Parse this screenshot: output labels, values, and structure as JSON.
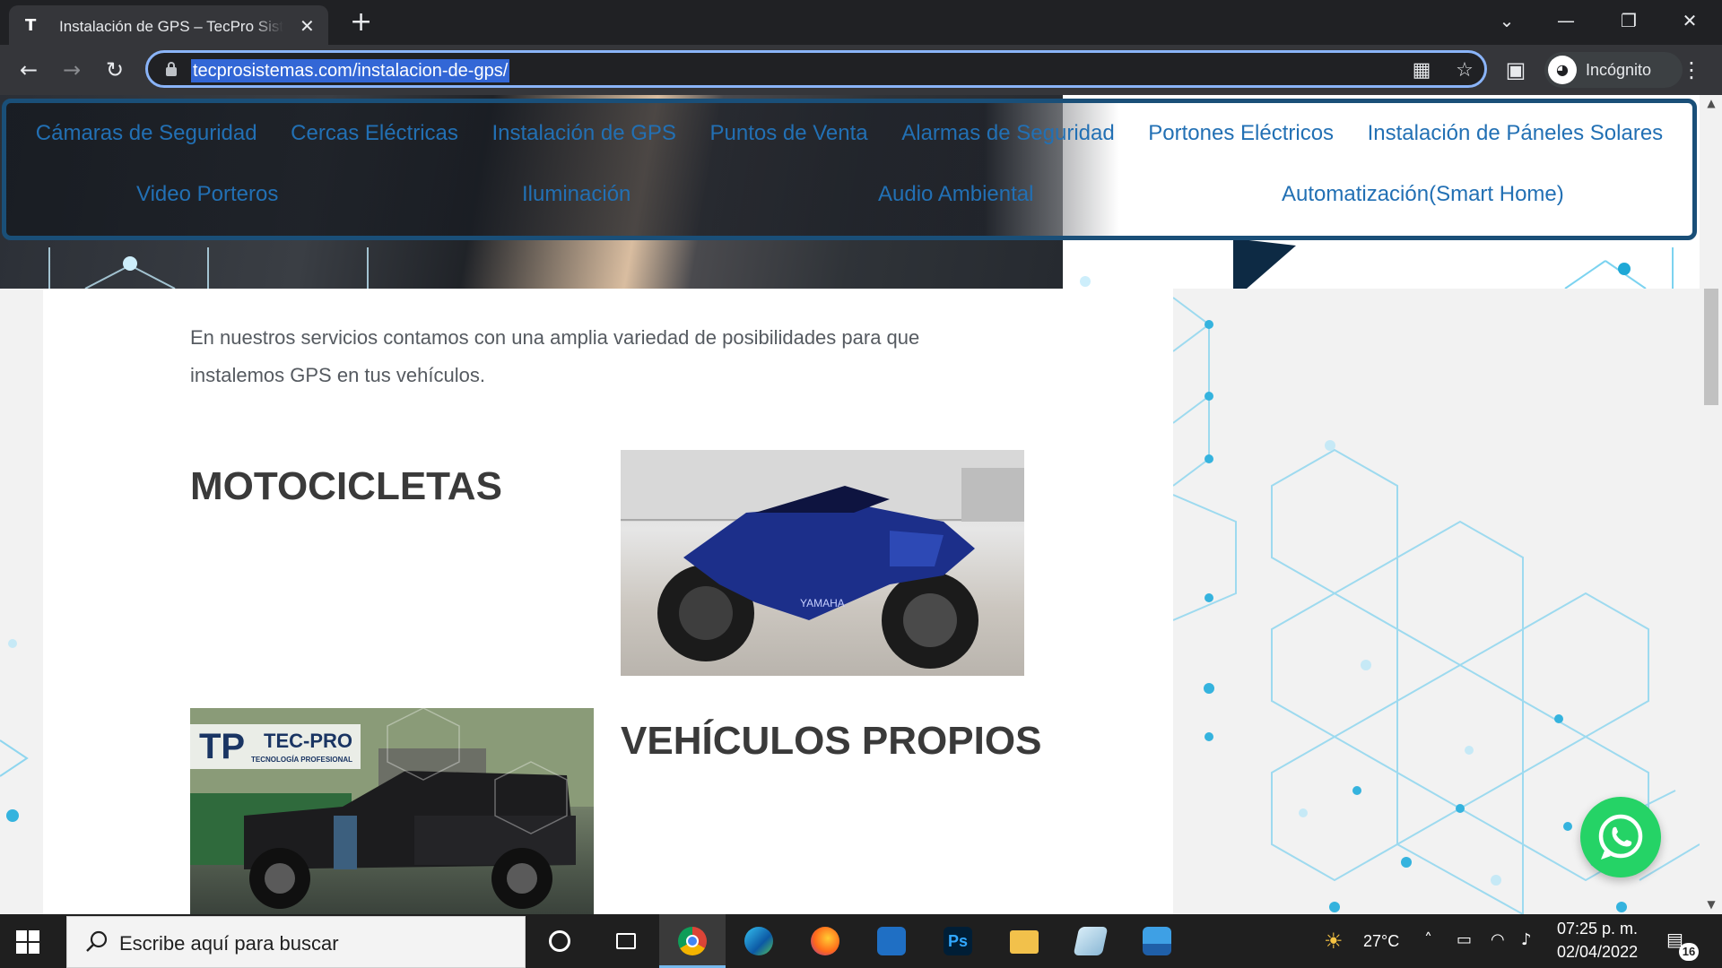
{
  "browser": {
    "tab_title": "Instalación de GPS – TecPro Sistemas",
    "tab_favicon": "T",
    "close_glyph": "✕",
    "new_tab_glyph": "+",
    "url": "tecprosistemas.com/instalacion-de-gps/",
    "incognito_label": "Incógnito",
    "icons": [
      "back-arrow-icon",
      "forward-arrow-icon",
      "reload-icon",
      "lock-icon",
      "qr-icon",
      "star-icon",
      "sidebar-icon",
      "incognito-icon",
      "menu-icon"
    ]
  },
  "nav": {
    "row1": [
      "Cámaras de Seguridad",
      "Cercas Eléctricas",
      "Instalación de GPS",
      "Puntos de Venta",
      "Alarmas de Seguridad",
      "Portones Eléctricos",
      "Instalación de Páneles Solares"
    ],
    "row2": [
      "Video Porteros",
      "Iluminación",
      "Audio Ambiental",
      "Automatización(Smart Home)"
    ],
    "color": "#2270b4",
    "border_color": "#1a4f78"
  },
  "content": {
    "intro": "En nuestros servicios contamos con una amplia variedad de posibilidades para que instalemos GPS en tus vehículos.",
    "sections": [
      {
        "title": "MOTOCICLETAS"
      },
      {
        "title": "VEHÍCULOS PROPIOS"
      }
    ],
    "truck_logo_title": "TEC-PRO",
    "truck_logo_sub": "TECNOLOGÍA PROFESIONAL",
    "moto_brand": "YAMAHA"
  },
  "whatsapp": {
    "icon": "whatsapp-icon",
    "color": "#25d366"
  },
  "taskbar": {
    "search_placeholder": "Escribe aquí para buscar",
    "apps": [
      "task-view-icon",
      "chrome-icon",
      "edge-icon",
      "firefox-icon",
      "app-icon",
      "photoshop-icon",
      "file-explorer-icon",
      "notepad-icon",
      "photos-icon"
    ],
    "photoshop_label": "Ps",
    "weather": "27°C",
    "time": "07:25 p. m.",
    "date": "02/04/2022",
    "notifications": "16"
  }
}
